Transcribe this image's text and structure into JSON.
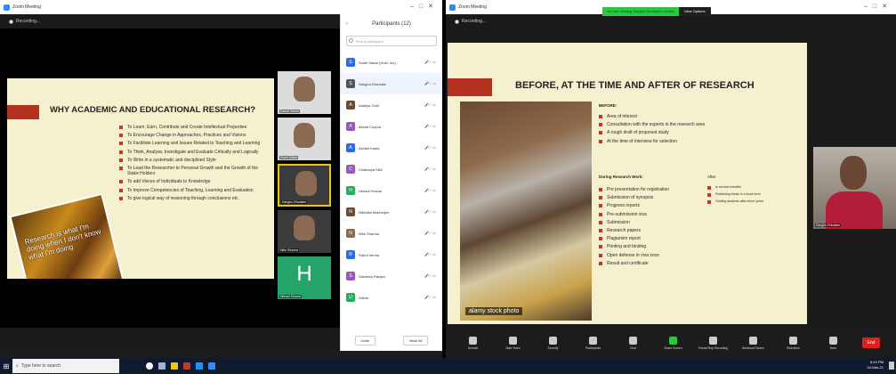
{
  "left": {
    "window_title": "Zoom Meeting",
    "recording": "Recording...",
    "slide": {
      "title": "WHY ACADEMIC AND EDUCATIONAL RESEARCH?",
      "image_text": "Research is what I'm doing when I don't know what I'm doing",
      "bullets": [
        "To Learn, Earn, Contribute and Create Intellectual Properties",
        "To Encourage Change in Approaches, Practices and Visions",
        "To Facilitate Learning and Issues Related to Teaching and Learning",
        "To Think, Analyse, Investigate and Evaluate Critically and Logically",
        "To Write in a systematic and disciplined Style",
        "To Lead the Researcher to Personal Growth and the Growth of the Stake Holders",
        "To add Voices of Individuals to Knowledge",
        "To Improve Competencies of Teaching, Learning and Evaluation",
        "To give logical way of reasoning through conclusions etc."
      ]
    },
    "tiles": [
      {
        "name": "Kamal Verma"
      },
      {
        "name": "Sumit Sattar"
      },
      {
        "name": "Sanghu Dhodake"
      },
      {
        "name": "Nitin Sharma"
      },
      {
        "name": "Himani Khanal",
        "letter": "H"
      }
    ],
    "participants": {
      "title": "Participants (12)",
      "search_placeholder": "Find a participant",
      "list": [
        {
          "initial": "S",
          "name": "Sumit Sattar (Host, me)",
          "color": "#2d6cdf"
        },
        {
          "initial": "S",
          "name": "Sanghu Dhodake",
          "color": "#555"
        },
        {
          "initial": "A",
          "name": "Aaditya Gore",
          "color": "#6b4a34"
        },
        {
          "initial": "A",
          "name": "Akhila Chopra",
          "color": "#9b59b6"
        },
        {
          "initial": "A",
          "name": "Ashish Kadia",
          "color": "#2d6cdf"
        },
        {
          "initial": "C",
          "name": "Chaitanya Sikh",
          "color": "#9b59b6"
        },
        {
          "initial": "H",
          "name": "Himani Khanal",
          "color": "#27ae60"
        },
        {
          "initial": "N",
          "name": "Nibedita Mukherjee",
          "color": "#6b4a34"
        },
        {
          "initial": "N",
          "name": "Nitin Sharma",
          "color": "#8a6a52"
        },
        {
          "initial": "R",
          "name": "Rahul Verma",
          "color": "#2d6cdf"
        },
        {
          "initial": "S",
          "name": "Sandeep Ranjan",
          "color": "#9b59b6"
        },
        {
          "initial": "U",
          "name": "Ulishe",
          "color": "#27ae60"
        }
      ],
      "invite": "Invite",
      "mute_all": "Mute All"
    }
  },
  "right": {
    "window_title": "Zoom Meeting",
    "recording": "Recording...",
    "share_banner": "You are viewing Sanghu Dhodake's screen",
    "view_options": "View Options",
    "slide": {
      "title": "BEFORE, AT THE TIME AND AFTER OF RESEARCH",
      "watermark": "alamy stock photo",
      "before_label": "BEFORE:",
      "before": [
        "Area of interest",
        "Consultation with the experts in the research area",
        "A rough draft of proposed study",
        "At the time of interview for selection"
      ],
      "during_label": "During Research Work:",
      "during": [
        "Pre presentation for registration",
        "Submission of synopsis",
        "Progress reports",
        "Pre-submission viva",
        "Submission",
        "Research papers",
        "Plagiarism report",
        "Printing and binding",
        "Open defense in viva voce",
        "Result and certificate"
      ],
      "after_label": "After",
      "after": [
        "In service benefits",
        "Publishing thesis in a book form",
        "Guiding students after three years"
      ]
    },
    "speaker_name": "Sanghu Dhodake",
    "toolbar": [
      {
        "label": "Unmute"
      },
      {
        "label": "Start Video"
      },
      {
        "label": "Security"
      },
      {
        "label": "Participants"
      },
      {
        "label": "Chat"
      },
      {
        "label": "Share Screen",
        "accent": true
      },
      {
        "label": "Pause/Stop Recording"
      },
      {
        "label": "Breakout Rooms"
      },
      {
        "label": "Reactions"
      },
      {
        "label": "More"
      }
    ],
    "end": "End"
  },
  "taskbar": {
    "search_placeholder": "Type here to search",
    "time": "8:10 PM",
    "date": "04-Mar-21"
  }
}
